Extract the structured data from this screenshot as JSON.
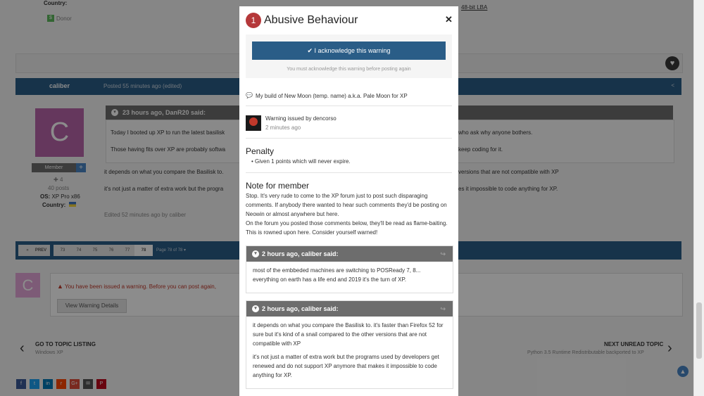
{
  "background": {
    "sidebar_top": {
      "country_label": "Country:",
      "donor_label": "Donor"
    },
    "top_link": "48-bit LBA",
    "post": {
      "author": "caliber",
      "posted": "Posted 55 minutes ago (edited)",
      "avatar_letter": "C",
      "role_badge": "Member",
      "rep": "4",
      "post_count": "40 posts",
      "os_label": "OS:",
      "os_value": "XP Pro x86",
      "country_label": "Country:",
      "quote_header": "23 hours ago, DanR20 said:",
      "quote_line1": "Today I booted up XP to run the latest basilisk",
      "quote_line1_tail": "who ask why anyone bothers.",
      "quote_line2": "Those having fits over XP are probably softwa",
      "quote_line2_tail": "keep coding for it.",
      "body_line1": "it depends on what you compare the Basilisk to.",
      "body_line1_tail": "versions that are not compatible with XP",
      "body_line2": "it's not just a matter of extra work but the progra",
      "body_line2_tail": "es it impossible to code anything for XP.",
      "edited": "Edited 52 minutes ago by caliber"
    },
    "pagination": {
      "prev": "PREV",
      "pages": [
        "73",
        "74",
        "75",
        "76",
        "77",
        "78"
      ],
      "page_info": "Page 78 of 78"
    },
    "warning_box": {
      "avatar_letter": "C",
      "message": "You have been issued a warning. Before you can post again,",
      "button": "View Warning Details"
    },
    "nav_prev": {
      "title": "GO TO TOPIC LISTING",
      "subtitle": "Windows XP"
    },
    "nav_next": {
      "title": "NEXT UNREAD TOPIC",
      "subtitle": "Python 3.5 Runtime Redistributable backported to XP"
    }
  },
  "modal": {
    "badge_number": "1",
    "title": "Abusive Behaviour",
    "close_glyph": "✕",
    "ack_button": "I acknowledge this warning",
    "ack_note": "You must acknowledge this warning before posting again",
    "topic": "My build of New Moon (temp. name) a.k.a. Pale Moon for XP",
    "issued_by": "Warning issued by dencorso",
    "issued_time": "2 minutes ago",
    "penalty_heading": "Penalty",
    "penalty_item": "Given 1 points which will never expire.",
    "note_heading": "Note for member",
    "note_para1": "Stop. It's very rude to come to the XP forum just to post such disparaging comments. If anybody there wanted to hear such comments they'd be posting on Neowin or almost anywhere but here.",
    "note_para2": "On the forum you posted those comments below, they'll be read as flame-baiting. This is rowned upon here. Consider yourself warned!",
    "quotes": [
      {
        "header": "2 hours ago, caliber said:",
        "paragraphs": [
          "most of the embbeded machines are switching to POSReady 7, 8... everything on earth has a life end and 2019 it's the turn of XP."
        ]
      },
      {
        "header": "2 hours ago, caliber said:",
        "paragraphs": [
          "it depends on what you compare the Basilisk to. it's faster than Firefox 52 for sure but it's kind of a snail compared to the other versions that are not compatible with XP",
          "it's not just a matter of extra work but the programs used by developers get renewed and do not support XP anymore that makes it impossible to code anything for XP."
        ]
      }
    ]
  },
  "colors": {
    "accent_blue": "#2a5d87",
    "badge_red": "#b5383a",
    "warning_red": "#c0392b",
    "quote_grey": "#6d6d6d"
  },
  "icons": [
    "heart-icon",
    "check-icon",
    "speech-bubble-icon",
    "close-icon",
    "chevron-down-icon",
    "share-icon",
    "chevron-left-icon",
    "chevron-right-icon",
    "scroll-top-icon",
    "warning-icon"
  ],
  "social_icons": [
    "f",
    "t",
    "in",
    "r",
    "G+",
    "✉",
    "P"
  ]
}
